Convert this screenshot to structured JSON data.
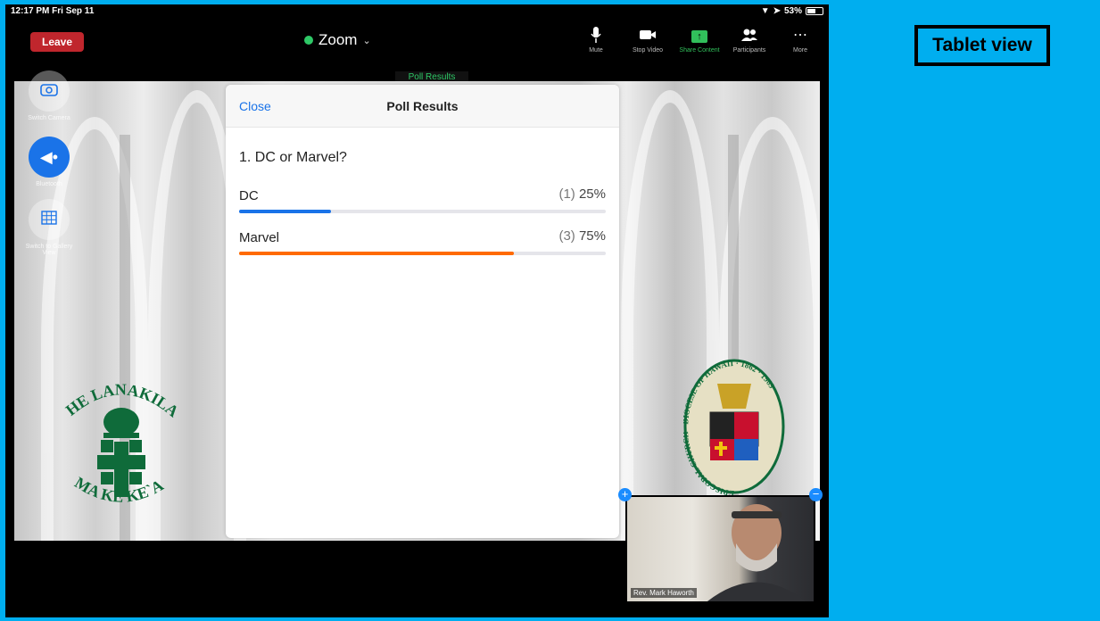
{
  "status_bar": {
    "time": "12:17 PM  Fri Sep 11",
    "battery": "53%"
  },
  "toolbar": {
    "leave_label": "Leave",
    "meeting_name": "Zoom",
    "tools": [
      {
        "label": "Mute",
        "icon": "microphone-icon"
      },
      {
        "label": "Stop Video",
        "icon": "video-camera-icon"
      },
      {
        "label": "Share Content",
        "icon": "share-screen-icon"
      },
      {
        "label": "Participants",
        "icon": "participants-icon"
      },
      {
        "label": "More",
        "icon": "more-icon"
      }
    ]
  },
  "poll_tag": "Poll Results",
  "side_controls": [
    {
      "label": "Switch Camera",
      "icon": "switch-camera-icon"
    },
    {
      "label": "Bluetooth",
      "icon": "speaker-icon"
    },
    {
      "label": "Switch to Gallery View",
      "icon": "gallery-grid-icon"
    }
  ],
  "poll": {
    "close_label": "Close",
    "title": "Poll Results",
    "question": "1. DC or Marvel?",
    "options": [
      {
        "label": "DC",
        "count": "(1)",
        "percent": "25%",
        "fraction": 0.25,
        "color": "#1a73e8"
      },
      {
        "label": "Marvel",
        "count": "(3)",
        "percent": "75%",
        "fraction": 0.75,
        "color": "#ff6a00"
      }
    ]
  },
  "logos": {
    "left_top": "HE LANAKILA",
    "left_bottom": "MA KE KE`A",
    "right_ring": "EPISCOPAL CHURCH · DIOCESE OF HAWAII · 1862 · 1969"
  },
  "self_view": {
    "name": "Rev. Mark Haworth"
  },
  "tablet_label": "Tablet view"
}
